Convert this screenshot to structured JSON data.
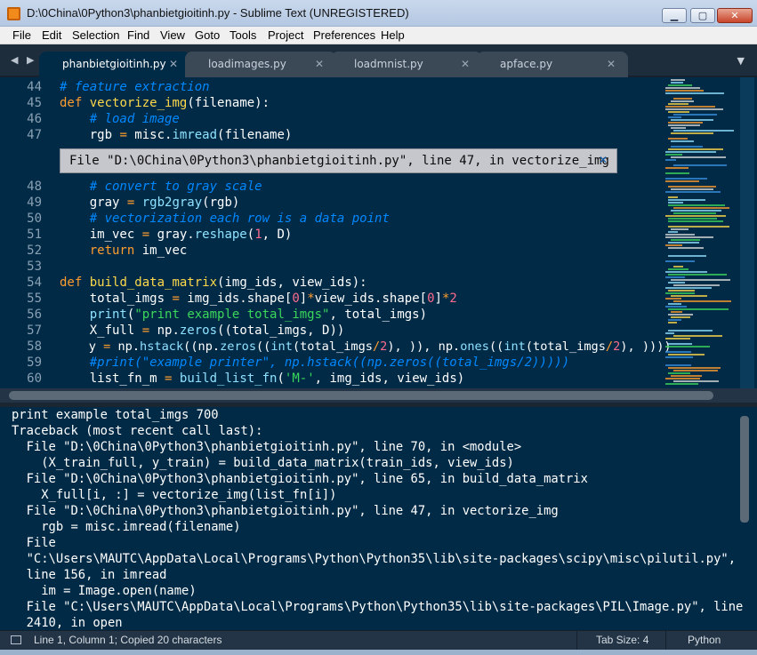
{
  "window": {
    "title": "D:\\0China\\0Python3\\phanbietgioitinh.py - Sublime Text (UNREGISTERED)"
  },
  "menu": [
    "File",
    "Edit",
    "Selection",
    "Find",
    "View",
    "Goto",
    "Tools",
    "Project",
    "Preferences",
    "Help"
  ],
  "tabs": [
    {
      "label": "phanbietgioitinh.py",
      "active": true
    },
    {
      "label": "loadimages.py",
      "active": false
    },
    {
      "label": "loadmnist.py",
      "active": false
    },
    {
      "label": "apface.py",
      "active": false
    }
  ],
  "editor": {
    "lines": [
      {
        "num": "44",
        "text": "# feature extraction"
      },
      {
        "num": "45",
        "text": "def vectorize_img(filename):"
      },
      {
        "num": "46",
        "text": "    # load image"
      },
      {
        "num": "47",
        "text": "    rgb = misc.imread(filename)"
      },
      {
        "num": "48",
        "text": "    # convert to gray scale"
      },
      {
        "num": "49",
        "text": "    gray = rgb2gray(rgb)"
      },
      {
        "num": "50",
        "text": "    # vectorization each row is a data point"
      },
      {
        "num": "51",
        "text": "    im_vec = gray.reshape(1, D)"
      },
      {
        "num": "52",
        "text": "    return im_vec"
      },
      {
        "num": "53",
        "text": ""
      },
      {
        "num": "54",
        "text": "def build_data_matrix(img_ids, view_ids):"
      },
      {
        "num": "55",
        "text": "    total_imgs = img_ids.shape[0]*view_ids.shape[0]*2"
      },
      {
        "num": "56",
        "text": "    print(\"print example total_imgs\", total_imgs)"
      },
      {
        "num": "57",
        "text": "    X_full = np.zeros((total_imgs, D))"
      },
      {
        "num": "58",
        "text": "    y = np.hstack((np.zeros((int(total_imgs/2), )), np.ones((int(total_imgs/2), ))))"
      },
      {
        "num": "59",
        "text": "    #print(\"example printer\", np.hstack((np.zeros((total_imgs/2)))))"
      },
      {
        "num": "60",
        "text": "    list_fn_m = build_list_fn('M-', img_ids, view_ids)"
      }
    ],
    "error_popup": "File \"D:\\0China\\0Python3\\phanbietgioitinh.py\", line 47, in vectorize_img"
  },
  "console": {
    "lines": [
      "print example total_imgs 700",
      "Traceback (most recent call last):",
      "  File \"D:\\0China\\0Python3\\phanbietgioitinh.py\", line 70, in <module>",
      "    (X_train_full, y_train) = build_data_matrix(train_ids, view_ids)",
      "  File \"D:\\0China\\0Python3\\phanbietgioitinh.py\", line 65, in build_data_matrix",
      "    X_full[i, :] = vectorize_img(list_fn[i])",
      "  File \"D:\\0China\\0Python3\\phanbietgioitinh.py\", line 47, in vectorize_img",
      "    rgb = misc.imread(filename)",
      "  File",
      "  \"C:\\Users\\MAUTC\\AppData\\Local\\Programs\\Python\\Python35\\lib\\site-packages\\scipy\\misc\\pilutil.py\",",
      "  line 156, in imread",
      "    im = Image.open(name)",
      "  File \"C:\\Users\\MAUTC\\AppData\\Local\\Programs\\Python\\Python35\\lib\\site-packages\\PIL\\Image.py\", line",
      "  2410, in open"
    ]
  },
  "status": {
    "position": "Line 1, Column 1; Copied 20 characters",
    "tab_size": "Tab Size: 4",
    "syntax": "Python"
  },
  "colors": {
    "editor_bg": "#002a46",
    "keyword": "#ff9d2f",
    "function": "#ffd94a",
    "comment": "#0088ff",
    "string": "#3bd75a",
    "number": "#ff6b8e"
  }
}
